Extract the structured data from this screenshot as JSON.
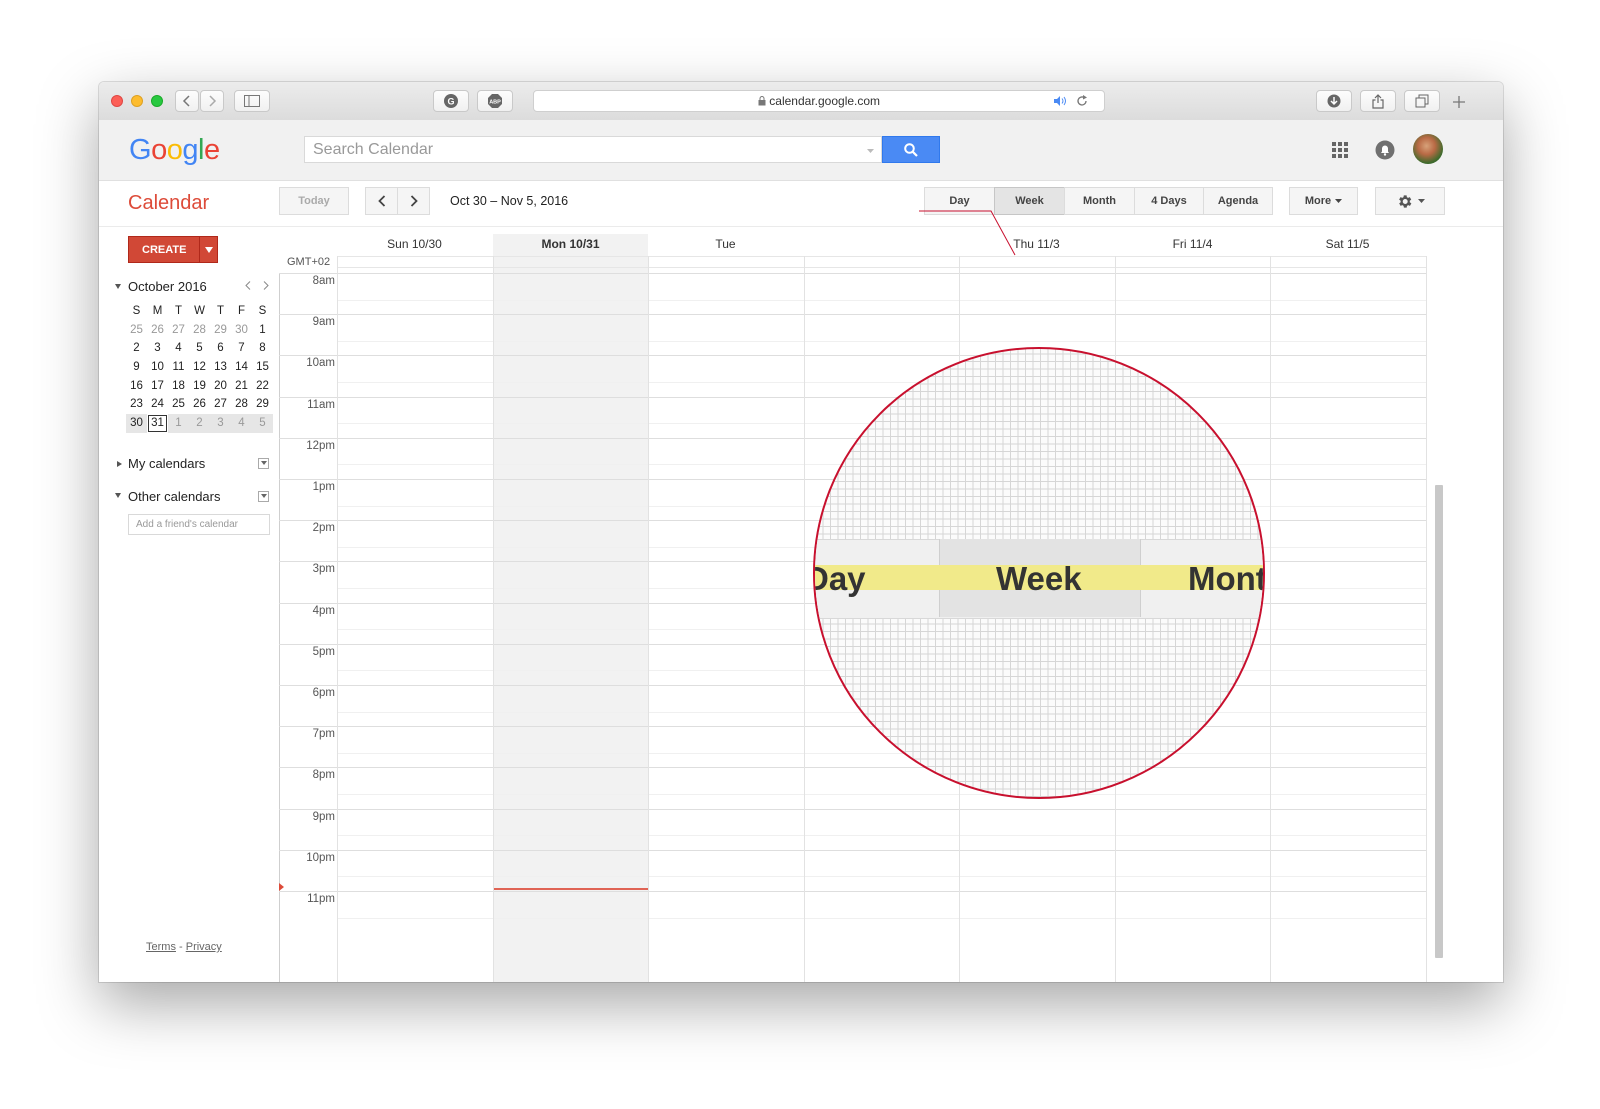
{
  "browser": {
    "url": "calendar.google.com"
  },
  "google": {
    "logo": "Google",
    "search_placeholder": "Search Calendar"
  },
  "toolbar": {
    "app_title": "Calendar",
    "today": "Today",
    "date_range": "Oct 30 – Nov 5, 2016",
    "views": [
      "Day",
      "Week",
      "Month",
      "4 Days",
      "Agenda"
    ],
    "active_view": "Week",
    "more": "More"
  },
  "sidebar": {
    "create": "CREATE",
    "mini_calendar": {
      "title": "October 2016",
      "weekdays": [
        "S",
        "M",
        "T",
        "W",
        "T",
        "F",
        "S"
      ],
      "weeks": [
        [
          "25",
          "26",
          "27",
          "28",
          "29",
          "30",
          "1"
        ],
        [
          "2",
          "3",
          "4",
          "5",
          "6",
          "7",
          "8"
        ],
        [
          "9",
          "10",
          "11",
          "12",
          "13",
          "14",
          "15"
        ],
        [
          "16",
          "17",
          "18",
          "19",
          "20",
          "21",
          "22"
        ],
        [
          "23",
          "24",
          "25",
          "26",
          "27",
          "28",
          "29"
        ],
        [
          "30",
          "31",
          "1",
          "2",
          "3",
          "4",
          "5"
        ]
      ],
      "today": "31"
    },
    "my_calendars": "My calendars",
    "other_calendars": "Other calendars",
    "add_friend_placeholder": "Add a friend's calendar",
    "terms": "Terms",
    "separator": " - ",
    "privacy": "Privacy"
  },
  "calendar": {
    "timezone": "GMT+02",
    "days": [
      "Sun 10/30",
      "Mon 10/31",
      "Tue",
      "",
      "Thu 11/3",
      "Fri 11/4",
      "Sat 11/5"
    ],
    "today_index": 1,
    "hours": [
      "8am",
      "9am",
      "10am",
      "11am",
      "12pm",
      "1pm",
      "2pm",
      "3pm",
      "4pm",
      "5pm",
      "6pm",
      "7pm",
      "8pm",
      "9pm",
      "10pm",
      "11pm"
    ],
    "current_time_marker": "10pm"
  },
  "magnifier": {
    "words": [
      "Day",
      "Week",
      "Mont"
    ]
  },
  "colors": {
    "brand_red": "#dd4b39",
    "create_red": "#d14836",
    "search_blue": "#4a8af4",
    "lens_red": "#c8102e",
    "highlight_yellow": "#f1ea8a"
  }
}
